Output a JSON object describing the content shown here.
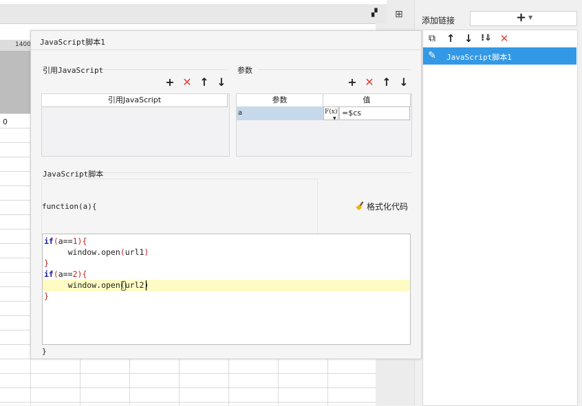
{
  "sheet": {
    "ruler_label": "1400",
    "cell_value": "0"
  },
  "right_panel": {
    "add_link_label": "添加链接",
    "add_button_glyph": "+",
    "toolbar_icons": [
      "copy-icon",
      "move-up-icon",
      "move-down-icon",
      "move-bottom-icon",
      "delete-icon"
    ],
    "list_items": [
      {
        "label": "JavaScript脚本1",
        "icon": "edit-icon",
        "selected": true
      }
    ]
  },
  "dialog": {
    "title": "JavaScript脚本1",
    "ref_js": {
      "section_label": "引用JavaScript",
      "column_header": "引用JavaScript",
      "rows": []
    },
    "params": {
      "section_label": "参数",
      "columns": [
        "参数",
        "值"
      ],
      "rows": [
        {
          "name": "a",
          "fx_label": "F(x)",
          "value": "=$cs"
        }
      ]
    },
    "script": {
      "section_label": "JavaScript脚本",
      "function_header": "function(a){",
      "format_button": "格式化代码",
      "closing": "}",
      "code_lines": [
        {
          "parts": [
            {
              "t": "if",
              "c": "kw"
            },
            {
              "t": "(",
              "c": "br"
            },
            {
              "t": "a==",
              "c": ""
            },
            {
              "t": "1",
              "c": "num"
            },
            {
              "t": "){",
              "c": "br"
            }
          ]
        },
        {
          "parts": [
            {
              "t": "     window.open",
              "c": ""
            },
            {
              "t": "(",
              "c": "br"
            },
            {
              "t": "url1",
              "c": ""
            },
            {
              "t": ")",
              "c": "br"
            }
          ]
        },
        {
          "parts": [
            {
              "t": "}",
              "c": "br"
            }
          ]
        },
        {
          "parts": [
            {
              "t": "if",
              "c": "kw"
            },
            {
              "t": "(",
              "c": "br"
            },
            {
              "t": "a==",
              "c": ""
            },
            {
              "t": "2",
              "c": "num"
            },
            {
              "t": "){",
              "c": "br"
            }
          ]
        },
        {
          "parts": [
            {
              "t": "     window.open",
              "c": ""
            },
            {
              "t": "(",
              "c": ""
            },
            {
              "t": "url2",
              "c": ""
            },
            {
              "t": ")",
              "c": ""
            }
          ]
        },
        {
          "parts": [
            {
              "t": "}",
              "c": "br"
            }
          ]
        }
      ],
      "highlighted_line": 5
    },
    "colors": {
      "delete_red": "#e0403a",
      "selection_blue": "#3399e6",
      "param_cell": "#c6d9ea",
      "highlight_line": "#fefcc4"
    }
  }
}
